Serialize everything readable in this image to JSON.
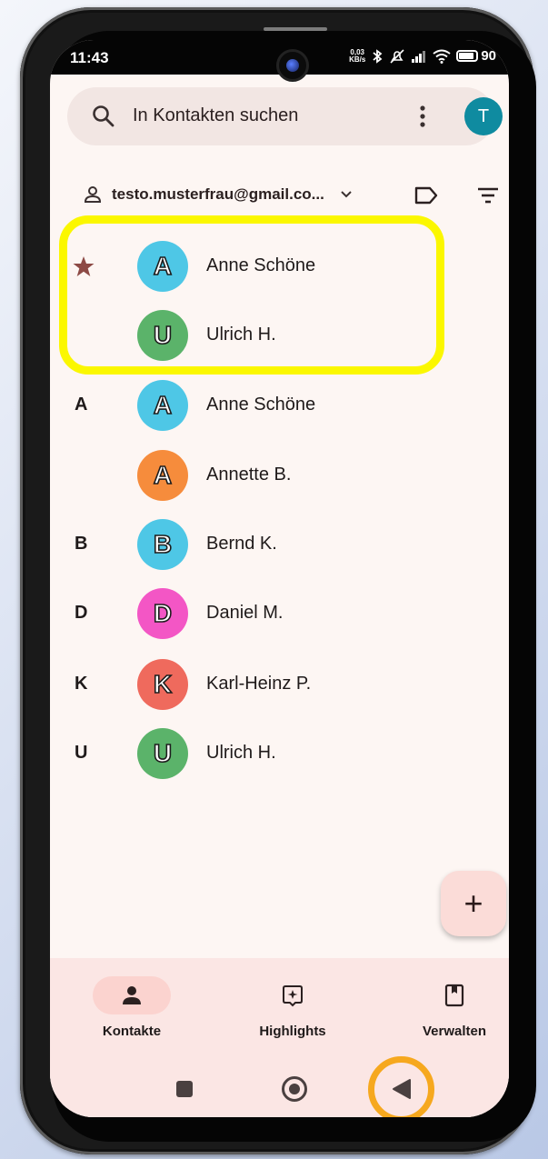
{
  "status_bar": {
    "time": "11:43",
    "net_speed_top": "0,03",
    "net_speed_bottom": "KB/s",
    "battery": "90"
  },
  "search": {
    "placeholder": "In Kontakten suchen",
    "account_initial": "T"
  },
  "account": {
    "email": "testo.musterfrau@gmail.co..."
  },
  "favorites": [
    {
      "initial": "A",
      "name": "Anne Schöne",
      "color": "#4ec7e6",
      "starred": true
    },
    {
      "initial": "U",
      "name": "Ulrich H.",
      "color": "#5bb36a",
      "starred": false
    }
  ],
  "contacts": [
    {
      "section": "A",
      "initial": "A",
      "name": "Anne Schöne",
      "color": "#4ec7e6"
    },
    {
      "section": "",
      "initial": "A",
      "name": "Annette B.",
      "color": "#f68c3c"
    },
    {
      "section": "B",
      "initial": "B",
      "name": "Bernd K.",
      "color": "#4ec7e6"
    },
    {
      "section": "D",
      "initial": "D",
      "name": "Daniel M.",
      "color": "#f356c5"
    },
    {
      "section": "K",
      "initial": "K",
      "name": "Karl-Heinz P.",
      "color": "#ef6a5d"
    },
    {
      "section": "U",
      "initial": "U",
      "name": "Ulrich H.",
      "color": "#5bb36a"
    }
  ],
  "fab": {
    "label": "+"
  },
  "bottom_nav": [
    {
      "label": "Kontakte",
      "icon": "person-icon",
      "active": true
    },
    {
      "label": "Highlights",
      "icon": "sparkle-icon",
      "active": false
    },
    {
      "label": "Verwalten",
      "icon": "book-icon",
      "active": false
    }
  ],
  "colors": {
    "highlight_box": "#fbf700",
    "back_ring": "#f6a81e",
    "star": "#8d4a45",
    "accent_avatar": "#0f8ba0"
  }
}
